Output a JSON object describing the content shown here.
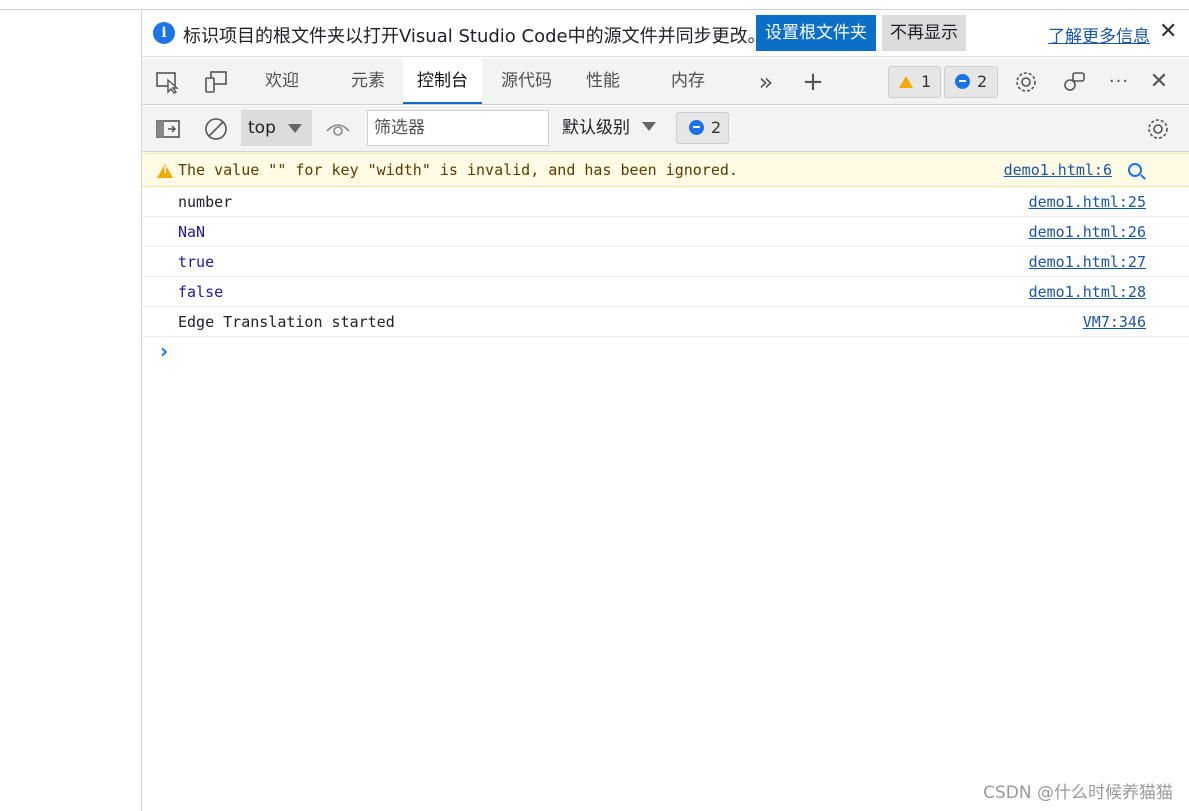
{
  "infobar": {
    "icon": "info-icon",
    "message": "标识项目的根文件夹以打开Visual Studio Code中的源文件并同步更改。",
    "primary_button": "设置根文件夹",
    "secondary_button": "不再显示",
    "learn_more": "了解更多信息",
    "close": "✕"
  },
  "tabbar": {
    "tabs": [
      "欢迎",
      "元素",
      "控制台",
      "源代码",
      "性能",
      "内存"
    ],
    "active_tab": "控制台",
    "more_tabs": "»",
    "add_tab": "+",
    "warnings_count": "1",
    "messages_count": "2",
    "more_options": "···",
    "close": "✕"
  },
  "console_toolbar": {
    "context": "top",
    "filter_placeholder": "筛选器",
    "level": "默认级别",
    "messages_count": "2"
  },
  "console": {
    "warning": {
      "text": "The value \"\" for key \"width\" is invalid, and has been ignored.",
      "source": "demo1.html:6"
    },
    "rows": [
      {
        "text": "number",
        "source": "demo1.html:25"
      },
      {
        "text": "NaN",
        "source": "demo1.html:26"
      },
      {
        "text": "true",
        "source": "demo1.html:27"
      },
      {
        "text": "false",
        "source": "demo1.html:28"
      },
      {
        "text": "Edge Translation started",
        "source": "VM7:346"
      }
    ],
    "prompt": "›"
  },
  "watermark": "CSDN @什么时候养猫猫",
  "colors": {
    "accent": "#0b6fc8",
    "warning_bg": "#fffbe5",
    "warning_icon": "#f2a900",
    "link": "#1a56a8"
  }
}
